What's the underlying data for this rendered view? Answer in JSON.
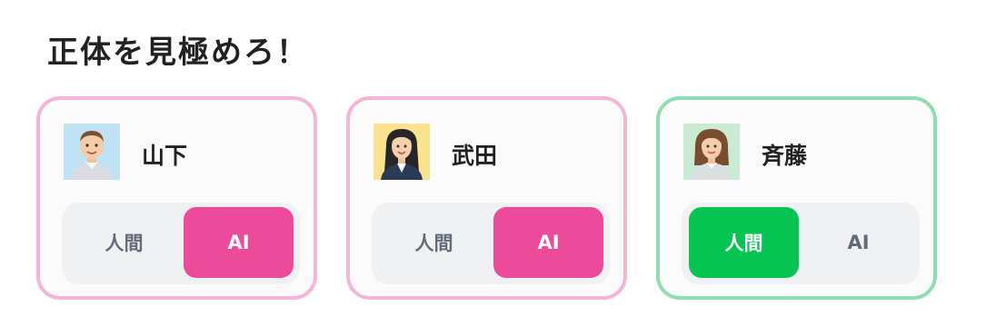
{
  "page": {
    "title": "正体を見極めろ！"
  },
  "cards": [
    {
      "name": "山下",
      "options": [
        "人間",
        "AI"
      ],
      "selected": "AI",
      "accent": "#ec4a9b",
      "avatar": "male-avatar-icon"
    },
    {
      "name": "武田",
      "options": [
        "人間",
        "AI"
      ],
      "selected": "AI",
      "accent": "#ec4a9b",
      "avatar": "female-avatar-icon"
    },
    {
      "name": "斉藤",
      "options": [
        "人間",
        "AI"
      ],
      "selected": "人間",
      "accent": "#08c553",
      "avatar": "female-avatar-icon"
    }
  ],
  "colors": {
    "ai_accent": "#ec4a9b",
    "human_accent": "#08c553",
    "ai_border": "#f4b6d7",
    "human_border": "#8fdfae"
  }
}
